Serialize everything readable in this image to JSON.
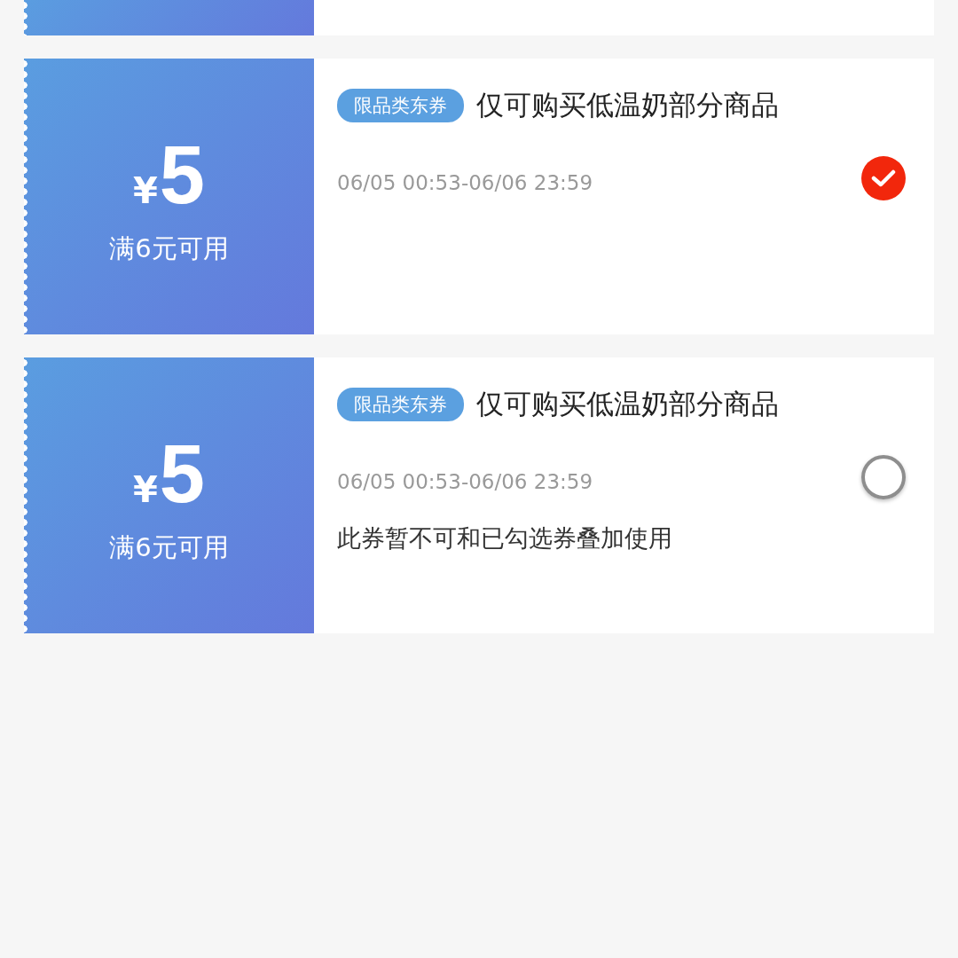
{
  "coupons": [
    {
      "currency": "¥",
      "amount": "5",
      "condition": "满6元可用",
      "tag": "限品类东券",
      "title": "仅可购买低温奶部分商品",
      "validity": "06/05 00:53-06/06 23:59",
      "selected": true
    },
    {
      "currency": "¥",
      "amount": "5",
      "condition": "满6元可用",
      "tag": "限品类东券",
      "title": "仅可购买低温奶部分商品",
      "validity": "06/05 00:53-06/06 23:59",
      "selected": false,
      "note": "此券暂不可和已勾选券叠加使用"
    }
  ]
}
